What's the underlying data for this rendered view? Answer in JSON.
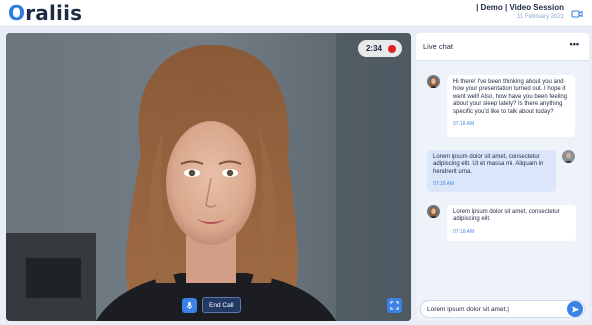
{
  "header": {
    "logo_prefix": "O",
    "logo_rest": "raliis",
    "session_title": "| Demo | Video Session",
    "session_date": "11 February 2021",
    "video_toggle_icon": "video-camera-icon"
  },
  "video": {
    "timer": "2:34",
    "recording_icon": "record-dot-icon",
    "mic_icon": "microphone-icon",
    "end_call_label": "End Call",
    "fullscreen_icon": "fullscreen-icon"
  },
  "chat": {
    "title": "Live chat",
    "more_icon": "more-horizontal-icon",
    "more_glyph": "•••",
    "messages": [
      {
        "direction": "incoming",
        "text": "Hi there! I've been thinking about you and how your presentation turned out. I hope it went well! Also, how have you been feeling about your sleep lately? Is there anything specific you'd like to talk about today?",
        "time": "07:18 AM"
      },
      {
        "direction": "outgoing",
        "text": "Lorem ipsum dolor sit amet, consectetur adipiscing elit. Ut et massa mi. Aliquam in hendrerit urna.",
        "time": "07:18 AM"
      },
      {
        "direction": "incoming",
        "text": "Lorem ipsum dolor sit amet, consectetur adipiscing elit.",
        "time": "07:18 AM"
      }
    ],
    "input_value": "Lorem ipsum dolor sit amet.|",
    "send_icon": "send-icon"
  },
  "colors": {
    "accent": "#3b82e6",
    "navy": "#1f2a44",
    "end_call_bg": "#223a63",
    "record": "#e02020"
  }
}
